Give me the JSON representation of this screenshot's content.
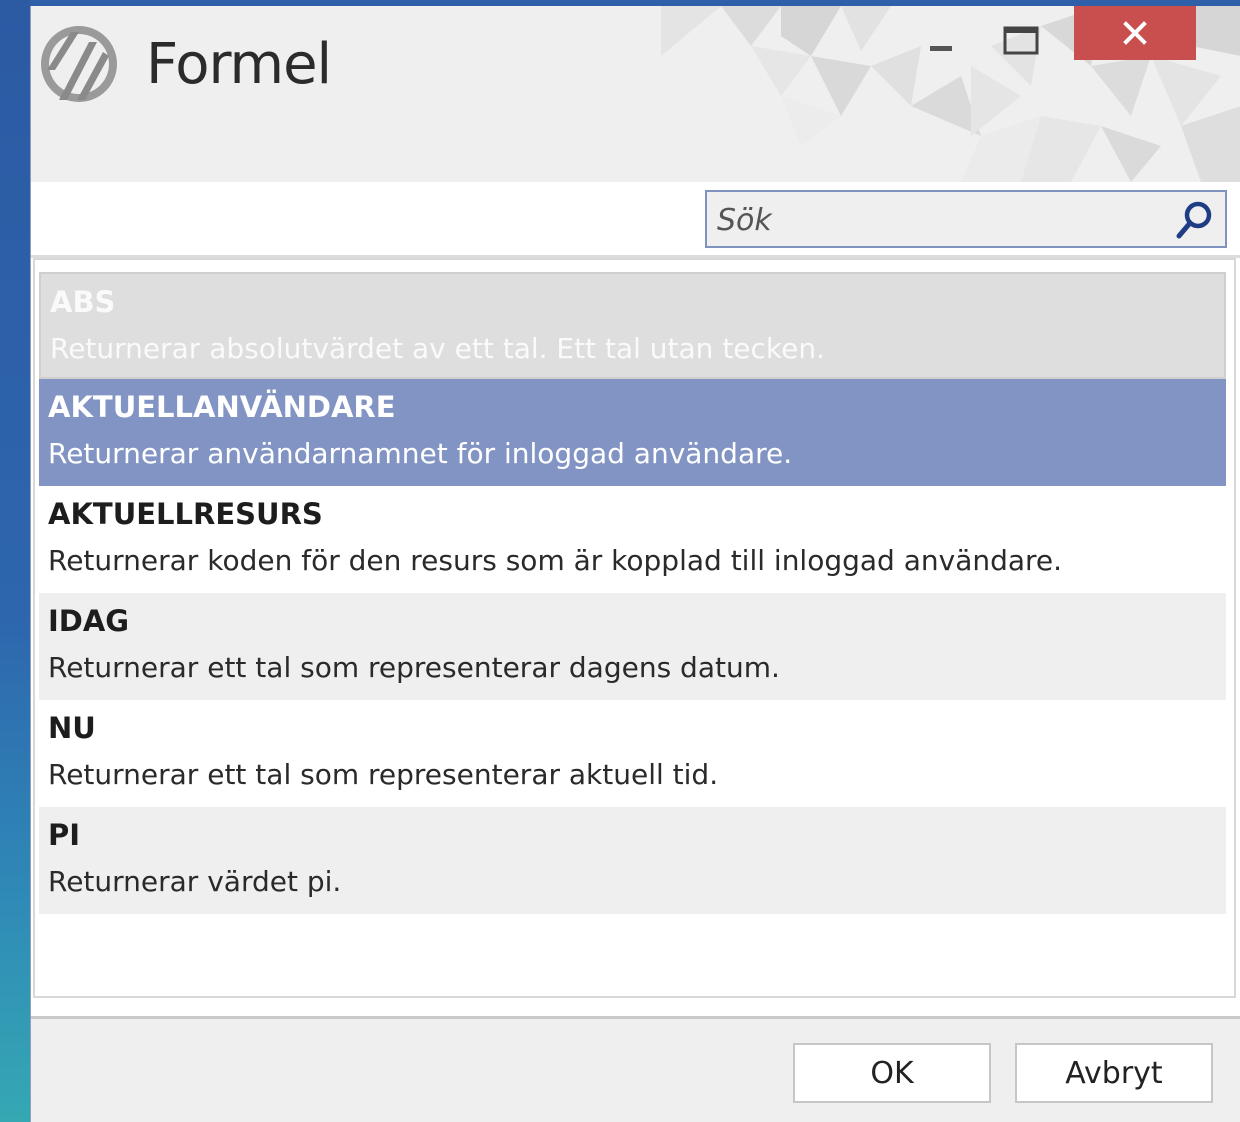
{
  "window": {
    "title": "Formel",
    "logo_icon": "brand-logo-icon",
    "controls": {
      "minimize_icon": "minimize-icon",
      "maximize_icon": "maximize-icon",
      "close_icon": "close-icon",
      "close_color": "#c94e4e"
    }
  },
  "search": {
    "placeholder": "Sök",
    "value": "",
    "icon": "search-icon"
  },
  "formulas": [
    {
      "name": "ABS",
      "description": "Returnerar absolutvärdet av ett tal. Ett tal utan tecken.",
      "state": "disabled"
    },
    {
      "name": "AKTUELLANVÄNDARE",
      "description": "Returnerar användarnamnet för inloggad användare.",
      "state": "selected"
    },
    {
      "name": "AKTUELLRESURS",
      "description": "Returnerar koden för den resurs som är kopplad till inloggad användare.",
      "state": "normal"
    },
    {
      "name": "IDAG",
      "description": "Returnerar ett tal som representerar dagens datum.",
      "state": "normal"
    },
    {
      "name": "NU",
      "description": "Returnerar ett tal som representerar aktuell tid.",
      "state": "normal"
    },
    {
      "name": "PI",
      "description": "Returnerar värdet pi.",
      "state": "normal"
    }
  ],
  "footer": {
    "ok_label": "OK",
    "cancel_label": "Avbryt"
  },
  "colors": {
    "selected_row": "#8294c4",
    "accent_border": "#7f93be"
  }
}
